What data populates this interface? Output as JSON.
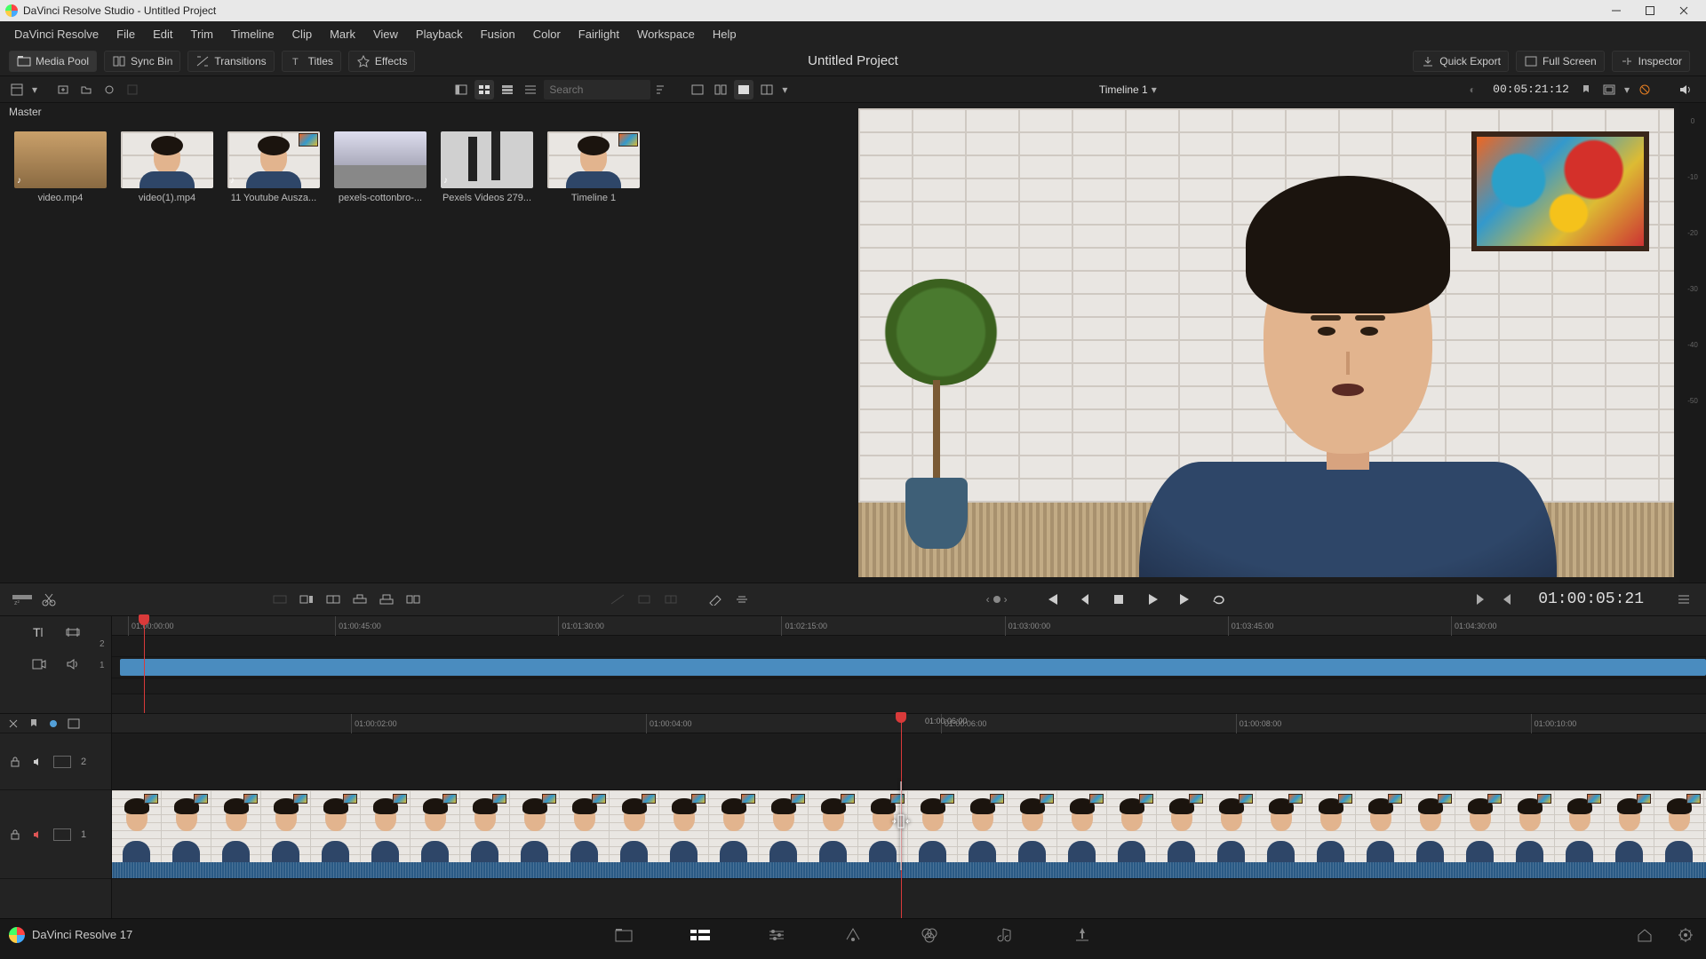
{
  "window": {
    "title": "DaVinci Resolve Studio - Untitled Project"
  },
  "menu": [
    "DaVinci Resolve",
    "File",
    "Edit",
    "Trim",
    "Timeline",
    "Clip",
    "Mark",
    "View",
    "Playback",
    "Fusion",
    "Color",
    "Fairlight",
    "Workspace",
    "Help"
  ],
  "panels": {
    "media_pool": "Media Pool",
    "sync_bin": "Sync Bin",
    "transitions": "Transitions",
    "titles": "Titles",
    "effects": "Effects",
    "quick_export": "Quick Export",
    "full_screen": "Full Screen",
    "inspector": "Inspector",
    "project_title": "Untitled Project"
  },
  "pool": {
    "bin": "Master",
    "search_placeholder": "Search",
    "clips": [
      {
        "name": "video.mp4",
        "kind": "beach"
      },
      {
        "name": "video(1).mp4",
        "kind": "face"
      },
      {
        "name": "11 Youtube Ausza...",
        "kind": "face"
      },
      {
        "name": "pexels-cottonbro-...",
        "kind": "street"
      },
      {
        "name": "Pexels Videos 279...",
        "kind": "legs"
      },
      {
        "name": "Timeline 1",
        "kind": "face"
      }
    ]
  },
  "viewer": {
    "timeline_name": "Timeline 1",
    "source_tc": "00:05:21:12",
    "record_tc": "01:00:05:21",
    "vu_marks": [
      "0",
      "-10",
      "-20",
      "-30",
      "-40",
      "-50"
    ]
  },
  "overview_ruler": [
    "01:00:00:00",
    "01:00:45:00",
    "01:01:30:00",
    "01:02:15:00",
    "01:03:00:00",
    "01:03:45:00",
    "01:04:30:00"
  ],
  "detail_ruler": [
    "01:00:02:00",
    "01:00:04:00",
    "01:00:06:00",
    "01:00:08:00",
    "01:00:10:00"
  ],
  "detail_hover_tc": "01:00:06:00",
  "tracks": {
    "v2": "2",
    "v1": "1",
    "a1": "1"
  },
  "footer": {
    "app": "DaVinci Resolve 17"
  }
}
